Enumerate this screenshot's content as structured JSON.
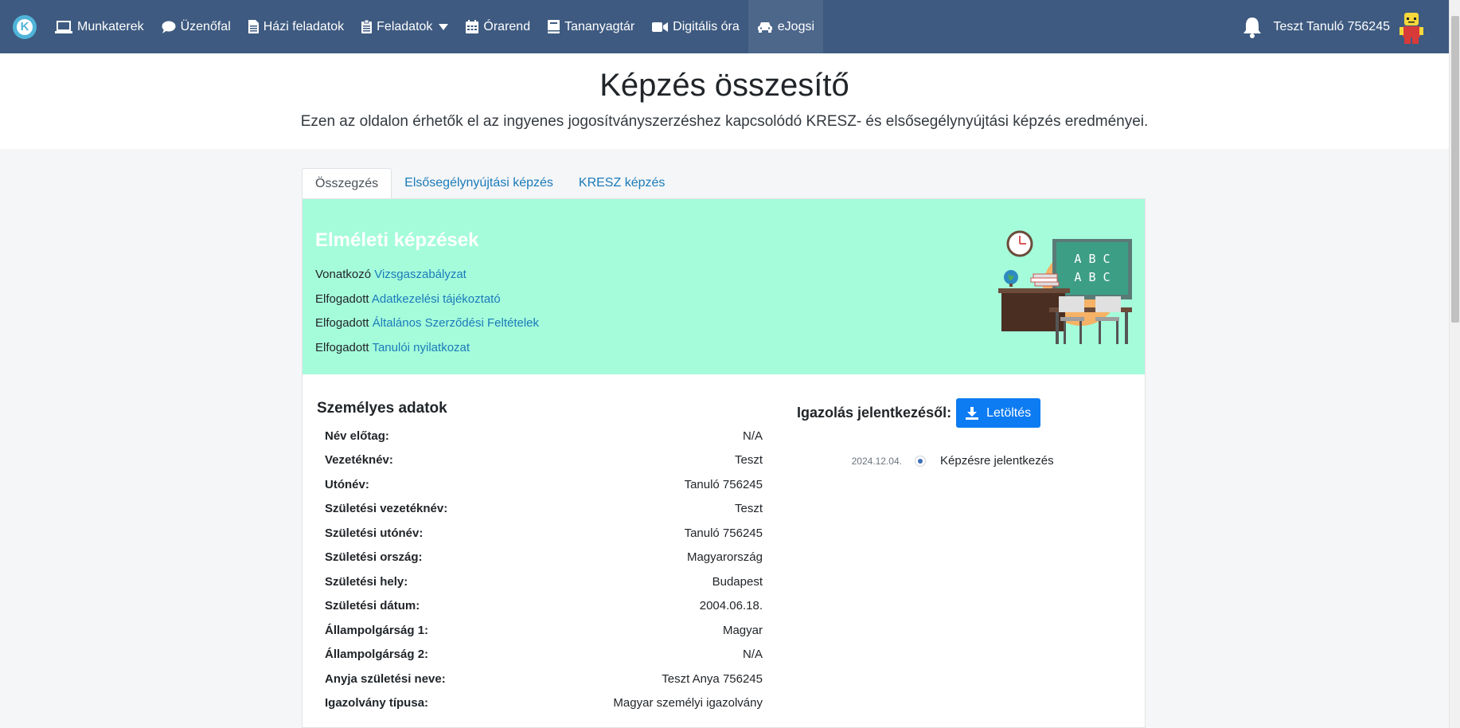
{
  "nav": {
    "logo_letter": "K",
    "items": [
      {
        "label": "Munkaterek",
        "icon": "laptop-icon"
      },
      {
        "label": "Üzenőfal",
        "icon": "chat-bubble-icon"
      },
      {
        "label": "Házi feladatok",
        "icon": "document-icon"
      },
      {
        "label": "Feladatok",
        "icon": "clipboard-icon"
      },
      {
        "label": "Órarend",
        "icon": "calendar-icon"
      },
      {
        "label": "Tananyagtár",
        "icon": "book-icon"
      },
      {
        "label": "Digitális óra",
        "icon": "video-camera-icon"
      },
      {
        "label": "eJogsi",
        "icon": "car-icon"
      }
    ],
    "user_name": "Teszt Tanuló 756245"
  },
  "header": {
    "title": "Képzés összesítő",
    "subtitle": "Ezen az oldalon érhetők el az ingyenes jogosítványszerzéshez kapcsolódó KRESZ- és elsősegélynyújtási képzés eredményei."
  },
  "tabs": [
    {
      "label": "Összegzés"
    },
    {
      "label": "Elsősegélynyújtási képzés"
    },
    {
      "label": "KRESZ képzés"
    }
  ],
  "theory": {
    "title": "Elméleti képzések",
    "lines": [
      {
        "prefix": "Vonatkozó",
        "link": "Vizsgaszabályzat"
      },
      {
        "prefix": "Elfogadott",
        "link": "Adatkezelési tájékoztató"
      },
      {
        "prefix": "Elfogadott",
        "link": "Általános Szerződési Feltételek"
      },
      {
        "prefix": "Elfogadott",
        "link": "Tanulói nyilatkozat"
      }
    ],
    "board_text": [
      "A B C",
      "A B C"
    ]
  },
  "personal": {
    "title": "Személyes adatok",
    "rows": [
      {
        "label": "Név előtag:",
        "value": "N/A"
      },
      {
        "label": "Vezetéknév:",
        "value": "Teszt"
      },
      {
        "label": "Utónév:",
        "value": "Tanuló 756245"
      },
      {
        "label": "Születési vezetéknév:",
        "value": "Teszt"
      },
      {
        "label": "Születési utónév:",
        "value": "Tanuló 756245"
      },
      {
        "label": "Születési ország:",
        "value": "Magyarország"
      },
      {
        "label": "Születési hely:",
        "value": "Budapest"
      },
      {
        "label": "Születési dátum:",
        "value": "2004.06.18."
      },
      {
        "label": "Állampolgárság 1:",
        "value": "Magyar"
      },
      {
        "label": "Állampolgárság 2:",
        "value": "N/A"
      },
      {
        "label": "Anyja születési neve:",
        "value": "Teszt Anya 756245"
      },
      {
        "label": "Igazolvány típusa:",
        "value": "Magyar személyi igazolvány"
      }
    ]
  },
  "certificate": {
    "label": "Igazolás jelentkezésől:",
    "button_label": "Letöltés"
  },
  "timeline": {
    "date": "2024.12.04.",
    "text": "Képzésre jelentkezés"
  },
  "colors": {
    "navbar": "#3e5a80",
    "theory_bg": "#a5fcdb",
    "link": "#1a7bb9",
    "download_button": "#0d7bf2"
  }
}
